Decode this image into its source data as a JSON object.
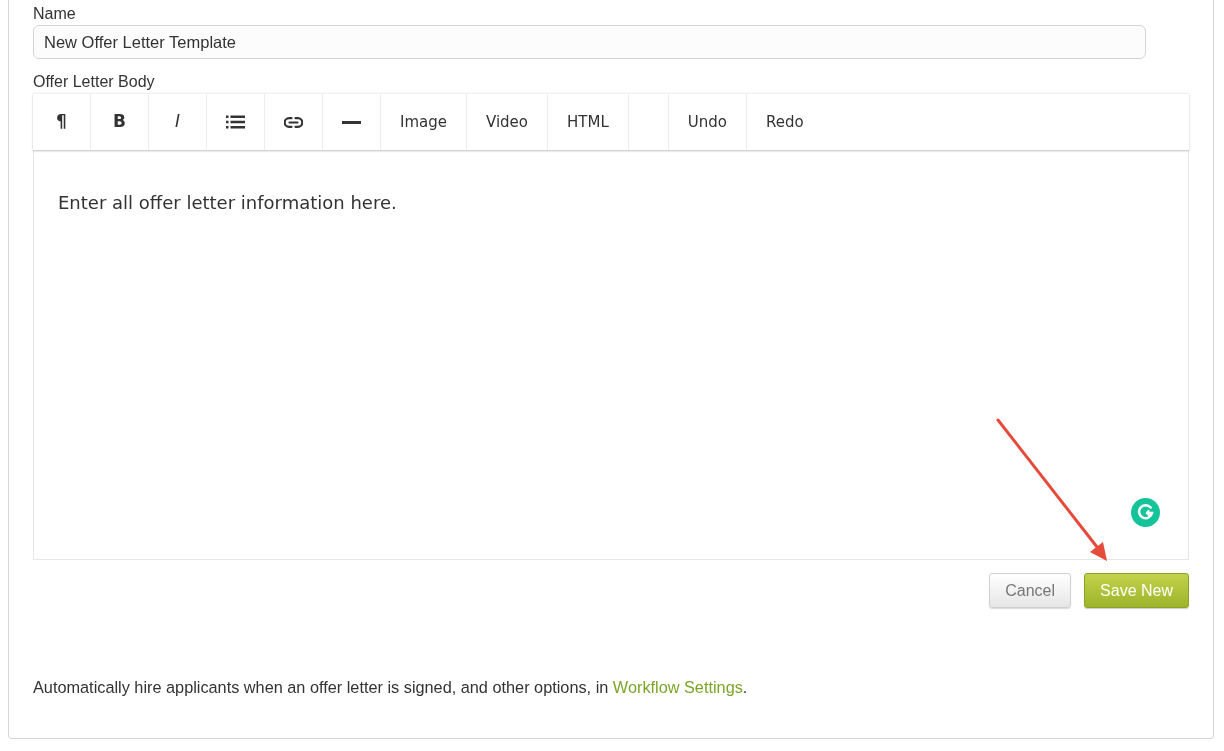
{
  "name_field": {
    "label": "Name",
    "value": "New Offer Letter Template"
  },
  "body_editor": {
    "label": "Offer Letter Body",
    "toolbar": [
      {
        "kind": "paragraph",
        "label": "¶"
      },
      {
        "kind": "bold",
        "label": "B"
      },
      {
        "kind": "italic",
        "label": "I"
      },
      {
        "kind": "list"
      },
      {
        "kind": "link"
      },
      {
        "kind": "rule"
      },
      {
        "kind": "text",
        "label": "Image"
      },
      {
        "kind": "text",
        "label": "Video"
      },
      {
        "kind": "text",
        "label": "HTML"
      },
      {
        "kind": "separator"
      },
      {
        "kind": "text",
        "label": "Undo"
      },
      {
        "kind": "text",
        "label": "Redo"
      }
    ],
    "content": "Enter all offer letter information here."
  },
  "buttons": [
    {
      "kind": "secondary",
      "label": "Cancel"
    },
    {
      "kind": "primary",
      "label": "Save New"
    }
  ],
  "footer": {
    "text": "Automatically hire applicants when an offer letter is signed, and other options, in ",
    "link": "Workflow Settings",
    "text_end": "."
  }
}
